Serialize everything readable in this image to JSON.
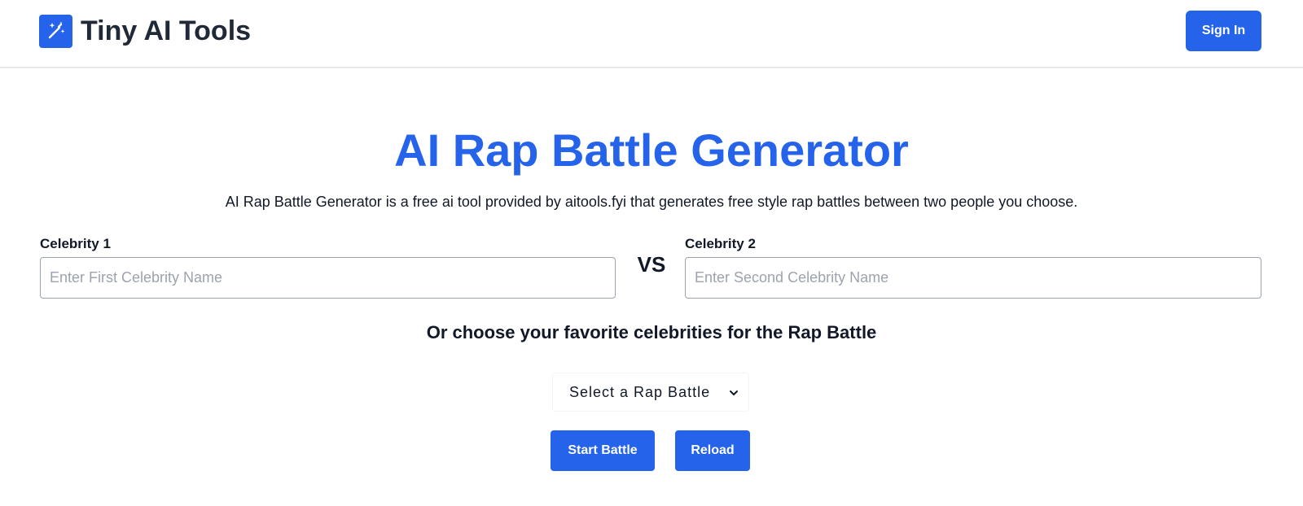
{
  "header": {
    "logo_text": "Tiny AI Tools",
    "logo_icon": "magic-wand-icon",
    "signin_label": "Sign In"
  },
  "main": {
    "title": "AI Rap Battle Generator",
    "description": "AI Rap Battle Generator is a free ai tool provided by aitools.fyi that generates free style rap battles between two people you choose.",
    "celebrity1": {
      "label": "Celebrity 1",
      "placeholder": "Enter First Celebrity Name",
      "value": ""
    },
    "vs_label": "VS",
    "celebrity2": {
      "label": "Celebrity 2",
      "placeholder": "Enter Second Celebrity Name",
      "value": ""
    },
    "choose_title": "Or choose your favorite celebrities for the Rap Battle",
    "battle_select": {
      "selected": "Select a Rap Battle",
      "icon": "chevron-down-icon"
    },
    "start_label": "Start Battle",
    "reload_label": "Reload"
  },
  "colors": {
    "accent": "#2563eb",
    "text": "#111827",
    "border": "#9ca3af",
    "divider": "#e5e7eb"
  }
}
